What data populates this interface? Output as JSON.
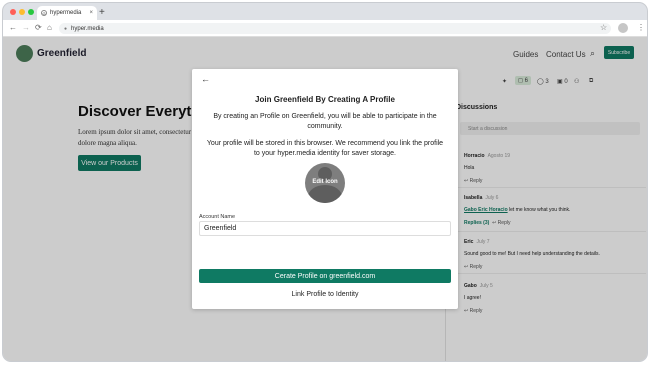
{
  "browser": {
    "tab_title": "hypermedia",
    "tab_close": "×",
    "new_tab": "+",
    "url": "hyper.media",
    "back": "←",
    "forward": "→",
    "reload": "⟳",
    "home": "⌂",
    "star": "☆",
    "menu": "⋮",
    "window_dots": [
      "#ff5f57",
      "#febc2e",
      "#28c840"
    ]
  },
  "site": {
    "brand": "Greenfield",
    "nav": [
      "Guides",
      "Contact Us"
    ],
    "subscribe_label": "Subscribe",
    "hero_title": "Discover Everything",
    "hero_text": "Lorem ipsum dolor sit amet, consectetur labore et dolore magna aliqua.",
    "hero_button": "View our Products",
    "accent": "#0f7a63"
  },
  "sidebar": {
    "comments_count": "6",
    "citations_count": "3",
    "versions_count": "0",
    "discussions_heading": "Discussions",
    "start_placeholder": "Start a discussion",
    "comments": [
      {
        "author": "Horracio",
        "date": "Agosto 19",
        "body": "Hola",
        "reply": "Reply"
      },
      {
        "author": "Isabella",
        "date": "July 6",
        "mention": "Gabo Eric Horacio",
        "body": " let me know what you think.",
        "replies": "Replies (3)",
        "reply": "Reply"
      },
      {
        "author": "Eric",
        "date": "July 7",
        "body": "Sound good to me! But I need help understanding the details.",
        "reply": "Reply"
      },
      {
        "author": "Gabo",
        "date": "July 5",
        "body": "I agree!",
        "reply": "Reply"
      }
    ]
  },
  "modal": {
    "title": "Join Greenfield By Creating A Profile",
    "para1": "By creating an Profile on Greenfield, you will be able to participate in the community.",
    "para2": "Your profile will be stored in this browser. We recommend you link the profile to your hyper.media identity for saver storage.",
    "avatar_label": "Edit Icon",
    "account_label": "Account Name",
    "account_value": "Greenfield",
    "primary_button": "Cerate Profile on greenfield.com",
    "secondary_button": "Link Profile to Identity"
  }
}
